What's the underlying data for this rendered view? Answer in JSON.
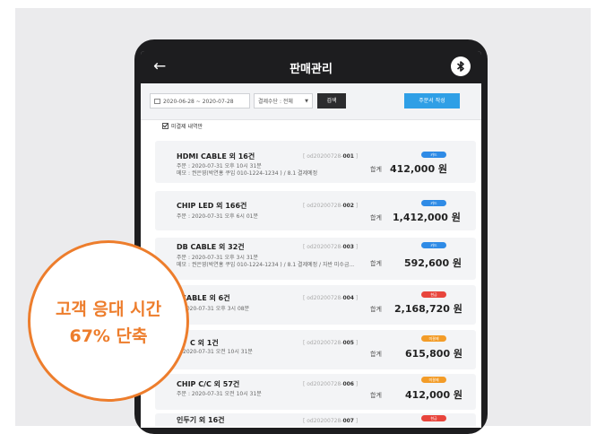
{
  "header": {
    "back_icon": "←",
    "title": "판매관리",
    "bluetooth_icon": "bluetooth-icon"
  },
  "toolbar": {
    "date_range": "2020-06-28 ~ 2020-07-28",
    "payment_filter": "결제수단 : 전체",
    "search_label": "검색",
    "new_order_label": "주문서 작성"
  },
  "filter": {
    "unpaid_label": "미결제 내역만"
  },
  "orders": [
    {
      "name": "HDMI CABLE 외 16건",
      "code_prefix": "[ od20200728-",
      "code_num": "001",
      "code_suffix": " ]",
      "date": "주문 : 2020-07-31 오후 10시 31분",
      "memo": "메모 : 권은영(박연홍 쿠입 010-1224-1234 ) / 8.1 결제예정",
      "total_label": "합계",
      "amount": "412,000 원",
      "badge": "카드",
      "badge_color": "#2f8be6"
    },
    {
      "name": "CHIP LED 외 166건",
      "code_prefix": "[ od20200728-",
      "code_num": "002",
      "code_suffix": " ]",
      "date": "주문 : 2020-07-31 오후 6시 01분",
      "total_label": "합계",
      "amount": "1,412,000 원",
      "badge": "카드",
      "badge_color": "#2f8be6"
    },
    {
      "name": "DB CABLE 외 32건",
      "code_prefix": "[ od20200728-",
      "code_num": "003",
      "code_suffix": " ]",
      "date": "주문 : 2020-07-31 오후 3시 31분",
      "memo": "메모 : 권은영(박연홍 쿠입 010-1224-1234 ) / 8.1 결제예정 / 자반 미수금...",
      "total_label": "합계",
      "amount": "592,600 원",
      "badge": "카드",
      "badge_color": "#2f8be6"
    },
    {
      "name": "CABLE 외 6건",
      "code_prefix": "[ od20200728-",
      "code_num": "004",
      "code_suffix": " ]",
      "date": "2020-07-31 오후 3시 08분",
      "total_label": "합계",
      "amount": "2,168,720 원",
      "badge": "현금",
      "badge_color": "#e8453c"
    },
    {
      "name": "C 외 1건",
      "code_prefix": "[ od20200728-",
      "code_num": "005",
      "code_suffix": " ]",
      "date": "2020-07-31 오전 10시 31분",
      "total_label": "합계",
      "amount": "615,800 원",
      "badge": "미결제",
      "badge_color": "#f39c28"
    },
    {
      "name": "CHIP C/C 외 57건",
      "code_prefix": "[ od20200728-",
      "code_num": "006",
      "code_suffix": " ]",
      "date": "주문 : 2020-07-31 오전 10시 31분",
      "total_label": "합계",
      "amount": "412,000 원",
      "badge": "미결제",
      "badge_color": "#f39c28"
    },
    {
      "name": "인두기 외 16건",
      "code_prefix": "[ od20200728-",
      "code_num": "007",
      "code_suffix": " ]",
      "badge": "현금",
      "badge_color": "#e8453c"
    }
  ],
  "callout": {
    "line1": "고객 응대 시간",
    "line2": "67% 단축"
  }
}
